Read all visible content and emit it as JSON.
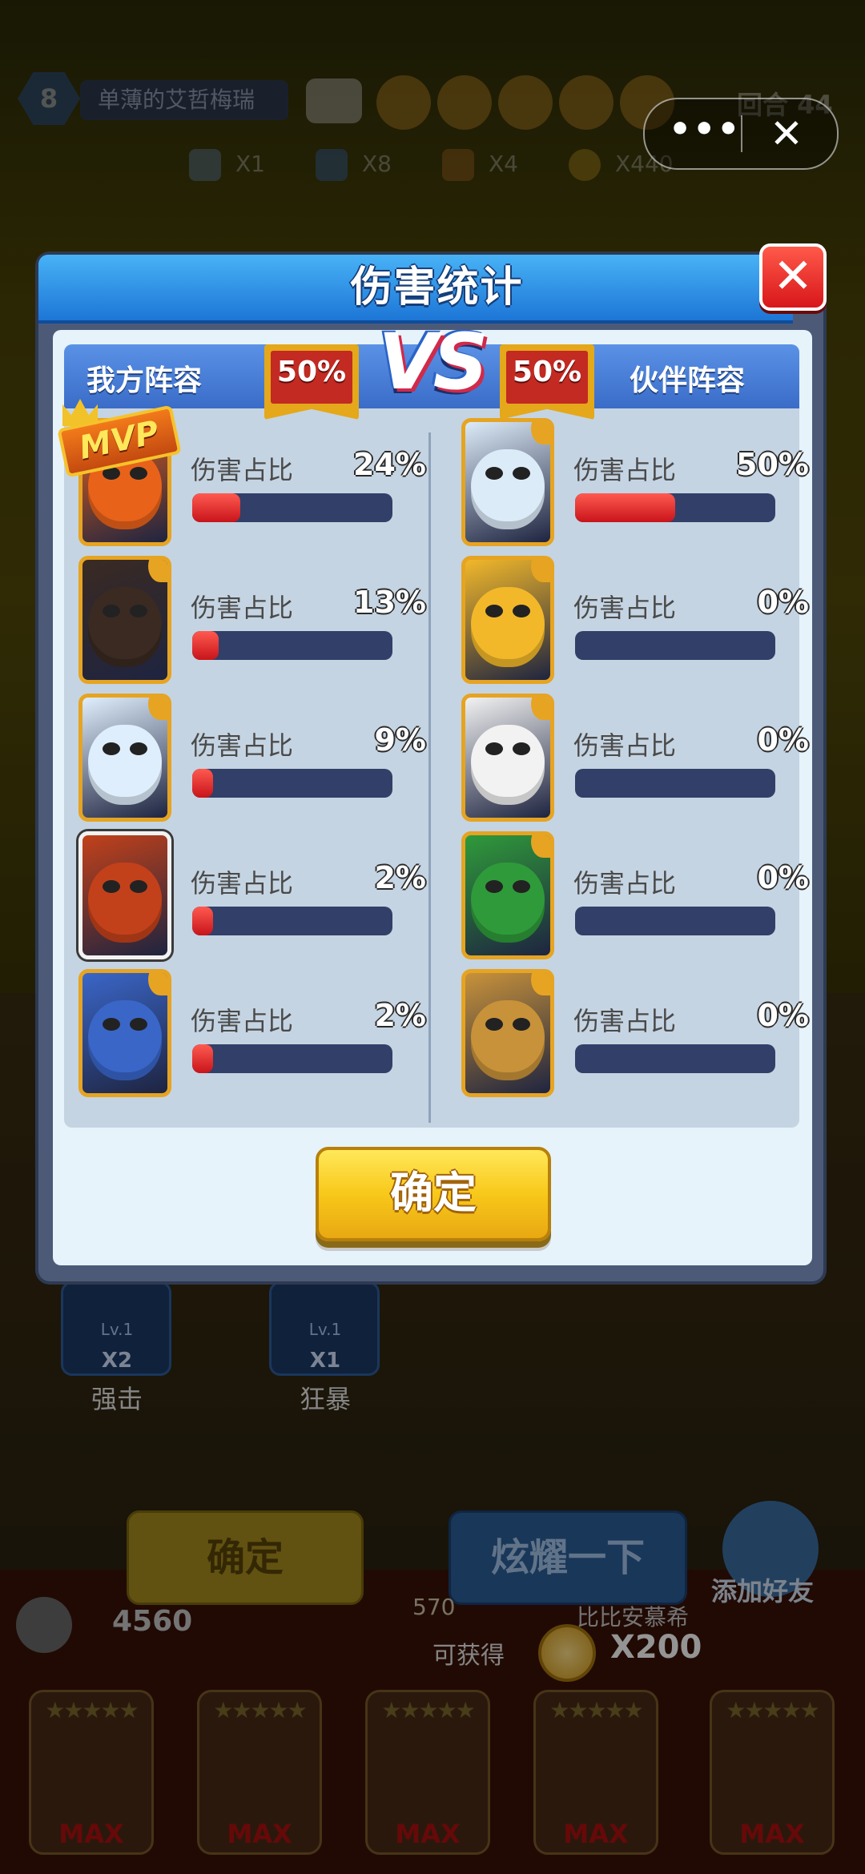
{
  "background": {
    "level": "8",
    "player_name": "单薄的艾哲梅瑞",
    "round_text": "回合 44",
    "resources": [
      "X1",
      "X8",
      "X4",
      "X440"
    ],
    "skills": [
      {
        "lv": "Lv.1",
        "count": "X2",
        "name": "强击"
      },
      {
        "lv": "Lv.1",
        "count": "X1",
        "name": "狂暴"
      }
    ],
    "confirm_label": "确定",
    "show_off_label": "炫耀一下",
    "add_friend_label": "添加好友",
    "score": "4560",
    "mid_score": "570",
    "other_player": "比比安慕希",
    "reward_label": "可获得",
    "reward_amount": "X200",
    "card_max": "MAX",
    "card_stars": "★★★★★"
  },
  "capsule": {
    "more_icon": "•••",
    "close_icon": "✕"
  },
  "dialog": {
    "title": "伤害统计",
    "close_icon": "✕",
    "vs_label": "VS",
    "mvp_label": "MVP",
    "confirm_label": "确定",
    "left_team": {
      "name": "我方阵容",
      "percent": "50%"
    },
    "right_team": {
      "name": "伙伴阵容",
      "percent": "50%"
    },
    "damage_label": "伤害占比",
    "left_heroes": [
      {
        "pct_text": "24%",
        "pct": 24,
        "color": "#e8621a"
      },
      {
        "pct_text": "13%",
        "pct": 13,
        "color": "#3a2a22"
      },
      {
        "pct_text": "9%",
        "pct": 9,
        "color": "#dfeefc"
      },
      {
        "pct_text": "2%",
        "pct": 2,
        "color": "#c2411a"
      },
      {
        "pct_text": "2%",
        "pct": 2,
        "color": "#3a66c8"
      }
    ],
    "right_heroes": [
      {
        "pct_text": "50%",
        "pct": 50,
        "color": "#dcebf8"
      },
      {
        "pct_text": "0%",
        "pct": 0,
        "color": "#f2b82a"
      },
      {
        "pct_text": "0%",
        "pct": 0,
        "color": "#f2f2f2"
      },
      {
        "pct_text": "0%",
        "pct": 0,
        "color": "#2f9a3a"
      },
      {
        "pct_text": "0%",
        "pct": 0,
        "color": "#c8923a"
      }
    ]
  }
}
